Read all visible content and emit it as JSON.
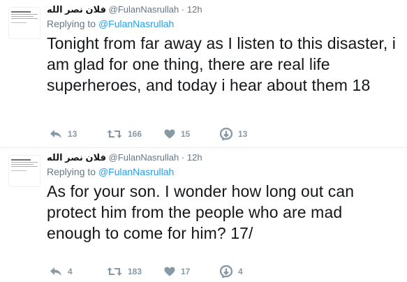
{
  "tweets": [
    {
      "name": "فلان نصر الله",
      "handle": "@FulanNasrullah",
      "separator": "·",
      "time": "12h",
      "replying_prefix": "Replying to",
      "replying_to": "@FulanNasrullah",
      "text": "Tonight from far away as I listen to this disaster, i am glad for one thing, there are real life superheroes, and today i hear about them 18",
      "reply_count": "13",
      "retweet_count": "166",
      "like_count": "15",
      "dm_count": "13"
    },
    {
      "name": "فلان نصر الله",
      "handle": "@FulanNasrullah",
      "separator": "·",
      "time": "12h",
      "replying_prefix": "Replying to",
      "replying_to": "@FulanNasrullah",
      "text": "As for your son. I wonder how long out can protect him from the people who are mad enough to come for him? 17/",
      "reply_count": "4",
      "retweet_count": "183",
      "like_count": "17",
      "dm_count": "4"
    }
  ],
  "colors": {
    "link": "#1da1f2",
    "secondary": "#657786",
    "icon": "#8899a6",
    "divider": "#e6ecf0"
  },
  "icons": {
    "reply": "reply-icon",
    "retweet": "retweet-icon",
    "like": "heart-icon",
    "dm": "message-icon"
  }
}
